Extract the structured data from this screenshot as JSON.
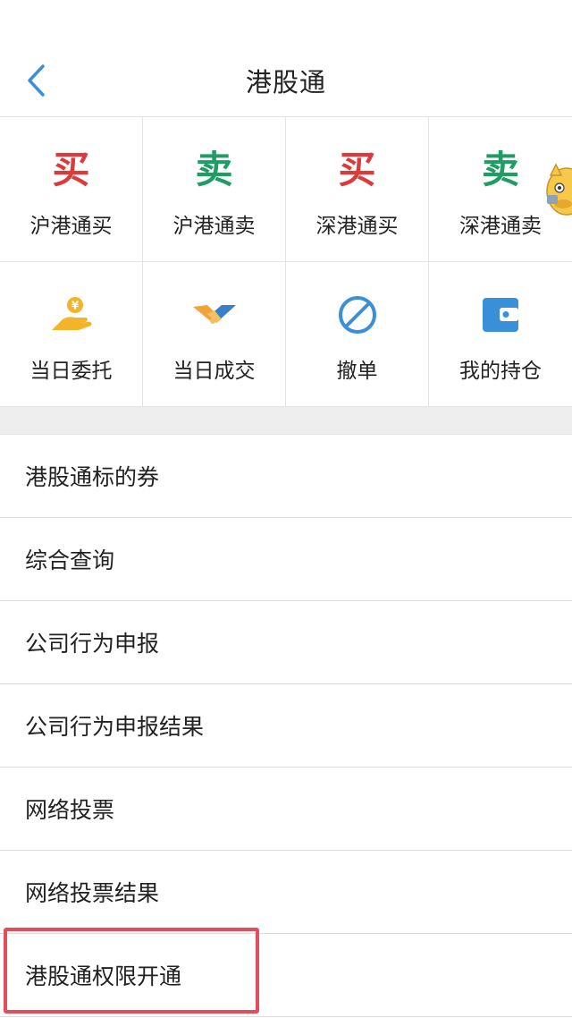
{
  "header": {
    "title": "港股通",
    "back_icon": "chevron-left-icon"
  },
  "grid": {
    "row1": [
      {
        "glyph": "买",
        "label": "沪港通买",
        "color": "#dc3b3b"
      },
      {
        "glyph": "卖",
        "label": "沪港通卖",
        "color": "#1f9e63"
      },
      {
        "glyph": "买",
        "label": "深港通买",
        "color": "#dc3b3b"
      },
      {
        "glyph": "卖",
        "label": "深港通卖",
        "color": "#1f9e63"
      }
    ],
    "row2": [
      {
        "icon": "coin-hand-icon",
        "label": "当日委托"
      },
      {
        "icon": "handshake-icon",
        "label": "当日成交"
      },
      {
        "icon": "cancel-circle-icon",
        "label": "撤单"
      },
      {
        "icon": "wallet-icon",
        "label": "我的持仓"
      }
    ]
  },
  "menu": [
    "港股通标的券",
    "综合查询",
    "公司行为申报",
    "公司行为申报结果",
    "网络投票",
    "网络投票结果",
    "港股通权限开通"
  ],
  "colors": {
    "accent": "#3a8fd9",
    "highlight": "#e44d5a",
    "buy": "#dc3b3b",
    "sell": "#1f9e63"
  }
}
